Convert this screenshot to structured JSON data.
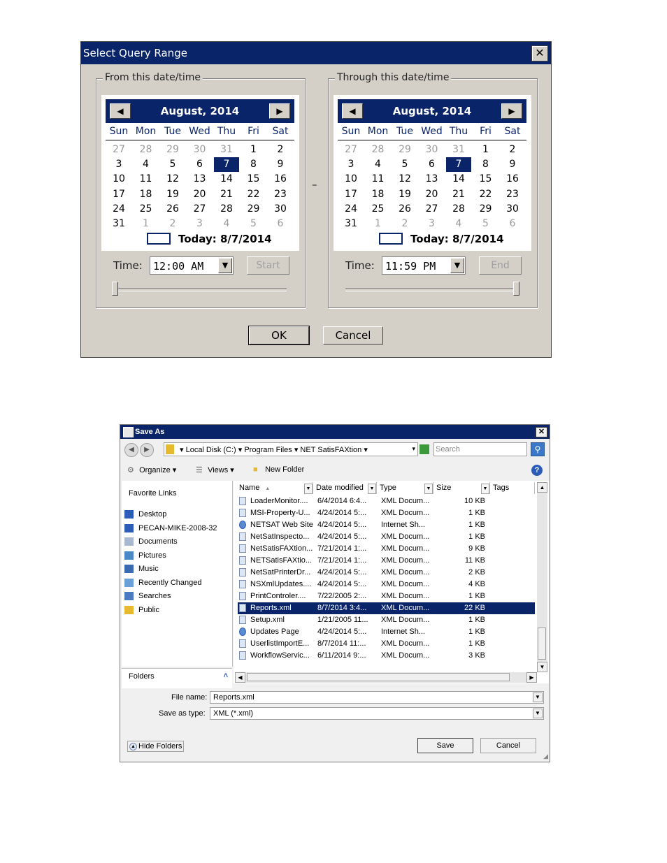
{
  "query_dialog": {
    "title": "Select Query Range",
    "close": "✕",
    "dash": "–",
    "ok": "OK",
    "cancel": "Cancel",
    "dow": [
      "Sun",
      "Mon",
      "Tue",
      "Wed",
      "Thu",
      "Fri",
      "Sat"
    ],
    "from": {
      "legend": "From this date/time",
      "month": "August, 2014",
      "today": "Today: 8/7/2014",
      "time_label": "Time:",
      "time": "12:00 AM",
      "button": "Start",
      "slider_value": 0.0
    },
    "through": {
      "legend": "Through this date/time",
      "month": "August, 2014",
      "today": "Today: 8/7/2014",
      "time_label": "Time:",
      "time": "11:59 PM",
      "button": "End",
      "slider_value": 1.0
    },
    "weeks": [
      [
        "27",
        "28",
        "29",
        "30",
        "31",
        "1",
        "2"
      ],
      [
        "3",
        "4",
        "5",
        "6",
        "7",
        "8",
        "9"
      ],
      [
        "10",
        "11",
        "12",
        "13",
        "14",
        "15",
        "16"
      ],
      [
        "17",
        "18",
        "19",
        "20",
        "21",
        "22",
        "23"
      ],
      [
        "24",
        "25",
        "26",
        "27",
        "28",
        "29",
        "30"
      ],
      [
        "31",
        "1",
        "2",
        "3",
        "4",
        "5",
        "6"
      ]
    ],
    "other_month_cells": [
      "0-0",
      "0-1",
      "0-2",
      "0-3",
      "0-4",
      "5-1",
      "5-2",
      "5-3",
      "5-4",
      "5-5",
      "5-6"
    ],
    "selected_cell": "1-4",
    "nav_prev": "◀",
    "nav_next": "▶",
    "dropdown": "▼"
  },
  "save_dialog": {
    "title": "Save As",
    "close": "✕",
    "address": {
      "segments": "▾ Local Disk (C:) ▾ Program Files ▾ NET SatisFAXtion ▾",
      "dropdown": "▾",
      "search_placeholder": "Search",
      "search_icon": "⚲"
    },
    "toolbar": {
      "organize": "Organize ▾",
      "views": "Views ▾",
      "new_folder": "New Folder",
      "help": "?"
    },
    "favorites_title": "Favorite Links",
    "favorites": [
      {
        "label": "Desktop",
        "color": "#2a5cb8"
      },
      {
        "label": "PECAN-MIKE-2008-32",
        "color": "#2a5cb8"
      },
      {
        "label": "Documents",
        "color": "#a8b8d0"
      },
      {
        "label": "Pictures",
        "color": "#4a88c8"
      },
      {
        "label": "Music",
        "color": "#3a6ab0"
      },
      {
        "label": "Recently Changed",
        "color": "#6aa0d8"
      },
      {
        "label": "Searches",
        "color": "#4a7ac0"
      },
      {
        "label": "Public",
        "color": "#e6b92e"
      }
    ],
    "folders_label": "Folders",
    "folders_chevron": "˄",
    "columns": [
      "Name",
      "Date modified",
      "Type",
      "Size",
      "Tags"
    ],
    "sort_arrow": "▲",
    "files": [
      {
        "name": "LoaderMonitor....",
        "date": "6/4/2014 6:4...",
        "type": "XML Docum...",
        "size": "10 KB",
        "icon": "xml"
      },
      {
        "name": "MSI-Property-U...",
        "date": "4/24/2014 5:...",
        "type": "XML Docum...",
        "size": "1 KB",
        "icon": "xml"
      },
      {
        "name": "NETSAT Web Site",
        "date": "4/24/2014 5:...",
        "type": "Internet Sh...",
        "size": "1 KB",
        "icon": "ie"
      },
      {
        "name": "NetSatInspecto...",
        "date": "4/24/2014 5:...",
        "type": "XML Docum...",
        "size": "1 KB",
        "icon": "xml"
      },
      {
        "name": "NetSatisFAXtion...",
        "date": "7/21/2014 1:...",
        "type": "XML Docum...",
        "size": "9 KB",
        "icon": "xml"
      },
      {
        "name": "NETSatisFAXtio...",
        "date": "7/21/2014 1:...",
        "type": "XML Docum...",
        "size": "11 KB",
        "icon": "xml"
      },
      {
        "name": "NetSatPrinterDr...",
        "date": "4/24/2014 5:...",
        "type": "XML Docum...",
        "size": "2 KB",
        "icon": "xml"
      },
      {
        "name": "NSXmlUpdates....",
        "date": "4/24/2014 5:...",
        "type": "XML Docum...",
        "size": "4 KB",
        "icon": "xml"
      },
      {
        "name": "PrintControler....",
        "date": "7/22/2005 2:...",
        "type": "XML Docum...",
        "size": "1 KB",
        "icon": "xml"
      },
      {
        "name": "Reports.xml",
        "date": "8/7/2014 3:4...",
        "type": "XML Docum...",
        "size": "22 KB",
        "icon": "xml",
        "selected": true
      },
      {
        "name": "Setup.xml",
        "date": "1/21/2005 11...",
        "type": "XML Docum...",
        "size": "1 KB",
        "icon": "xml"
      },
      {
        "name": "Updates Page",
        "date": "4/24/2014 5:...",
        "type": "Internet Sh...",
        "size": "1 KB",
        "icon": "ie"
      },
      {
        "name": "UserlistImportE...",
        "date": "8/7/2014 11:...",
        "type": "XML Docum...",
        "size": "1 KB",
        "icon": "xml"
      },
      {
        "name": "WorkflowServic...",
        "date": "6/11/2014 9:...",
        "type": "XML Docum...",
        "size": "3 KB",
        "icon": "xml"
      }
    ],
    "file_name_label": "File name:",
    "file_name": "Reports.xml",
    "save_type_label": "Save as type:",
    "save_type": "XML (*.xml)",
    "hide_folders": "Hide Folders",
    "save": "Save",
    "cancel": "Cancel"
  }
}
